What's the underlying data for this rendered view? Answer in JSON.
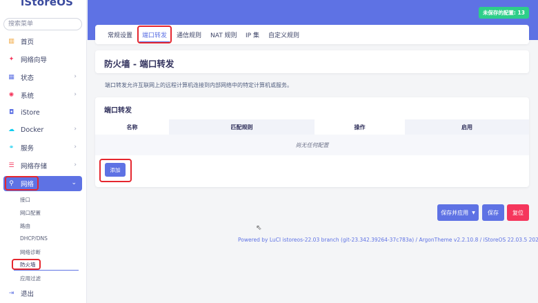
{
  "brand": "iStoreOS",
  "search": {
    "placeholder": "搜索菜单"
  },
  "menu": [
    {
      "label": "首页",
      "icon": "home-icon",
      "glyph": "▥",
      "color": "#f0a030"
    },
    {
      "label": "网络向导",
      "icon": "wizard-icon",
      "glyph": "✦",
      "color": "#f5365c"
    },
    {
      "label": "状态",
      "icon": "status-icon",
      "glyph": "▦",
      "color": "#5e72e4"
    },
    {
      "label": "系统",
      "icon": "system-gear-icon",
      "glyph": "✺",
      "color": "#f5365c"
    },
    {
      "label": "iStore",
      "icon": "istore-icon",
      "glyph": "◘",
      "color": "#5e72e4"
    },
    {
      "label": "Docker",
      "icon": "docker-icon",
      "glyph": "☁",
      "color": "#11cdef"
    },
    {
      "label": "服务",
      "icon": "services-icon",
      "glyph": "⚭",
      "color": "#11cdef"
    },
    {
      "label": "网络存储",
      "icon": "nas-icon",
      "glyph": "☰",
      "color": "#f5365c"
    },
    {
      "label": "网络",
      "icon": "network-icon",
      "glyph": "⚲",
      "color": "#ffffff"
    }
  ],
  "submenu": [
    "接口",
    "网口配置",
    "路由",
    "DHCP/DNS",
    "网络诊断",
    "防火墙",
    "应用过滤"
  ],
  "logout": "退出",
  "unsaved": "未保存的配置: 13",
  "tabs": [
    "常规设置",
    "端口转发",
    "通信规则",
    "NAT 规则",
    "IP 集",
    "自定义规则"
  ],
  "page_title": "防火墙 - 端口转发",
  "description": "端口转发允许互联网上的远程计算机连接到内部网络中的特定计算机或服务。",
  "section": {
    "title": "端口转发",
    "columns": [
      "名称",
      "匹配规则",
      "操作",
      "启用"
    ],
    "empty": "尚无任何配置",
    "add": "添加"
  },
  "buttons": {
    "apply": "保存并应用",
    "save": "保存",
    "reset": "复位"
  },
  "footer": {
    "text": "Powered by LuCI istoreos-22.03 branch (git-23.342.39264-37c783a) / ArgonTheme v2.2.10.8 / iStoreOS 22.03.5 2023121510"
  },
  "colors": {
    "accent": "#5e72e4",
    "success": "#2dce89",
    "danger": "#f5365c"
  }
}
